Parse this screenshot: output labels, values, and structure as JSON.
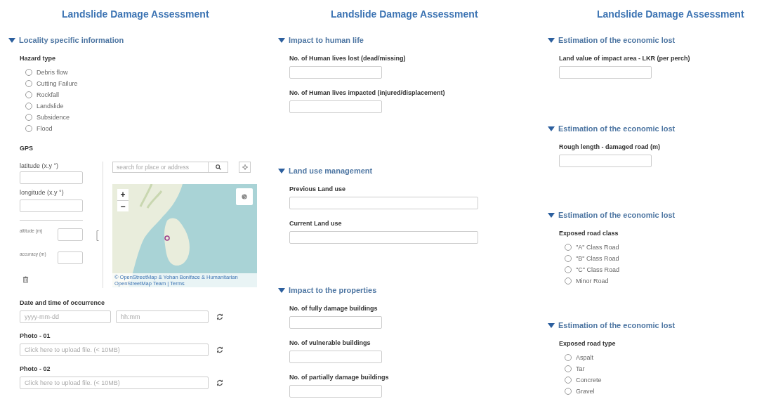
{
  "columns": [
    {
      "title": "Landslide Damage Assessment",
      "sections": [
        {
          "title": "Locality specific information",
          "expanded": true,
          "fields": [
            {
              "kind": "radio",
              "label": "Hazard type",
              "options": [
                {
                  "label": "Debris flow",
                  "selected": false
                },
                {
                  "label": "Cutting Failure",
                  "selected": false
                },
                {
                  "label": "Rockfall",
                  "selected": false
                },
                {
                  "label": "Landslide",
                  "selected": false
                },
                {
                  "label": "Subsidence",
                  "selected": false
                },
                {
                  "label": "Flood",
                  "selected": false
                }
              ]
            },
            {
              "kind": "gps",
              "label": "GPS",
              "latitude_label": "latitude (x.y °)",
              "longitude_label": "longitude (x.y °)",
              "altitude_label": "altitude (m)",
              "accuracy_label": "accuracy (m)",
              "search_placeholder": "search for place or address",
              "zoom_in": "+",
              "zoom_out": "−",
              "attribution": "© OpenStreetMap & Yohan Boniface & Humanitarian OpenStreetMap Team | Terms"
            },
            {
              "kind": "datetime",
              "label": "Date and time of occurrence",
              "date_placeholder": "yyyy-mm-dd",
              "time_placeholder": "hh:mm"
            },
            {
              "kind": "upload",
              "label": "Photo - 01",
              "placeholder": "Click here to upload file. (< 10MB)"
            },
            {
              "kind": "upload",
              "label": "Photo - 02",
              "placeholder": "Click here to upload file. (< 10MB)"
            }
          ]
        }
      ]
    },
    {
      "title": "Landslide Damage Assessment",
      "sections": [
        {
          "title": "Impact to human life",
          "expanded": true,
          "fields": [
            {
              "kind": "text",
              "label": "No. of Human lives lost (dead/missing)"
            },
            {
              "kind": "text",
              "label": "No. of Human lives impacted (injured/displacement)"
            }
          ]
        },
        {
          "title": "Land use management",
          "expanded": true,
          "fields": [
            {
              "kind": "text",
              "label": "Previous Land use"
            },
            {
              "kind": "text",
              "label": "Current Land use"
            }
          ]
        },
        {
          "title": "Impact to the properties",
          "expanded": true,
          "fields": [
            {
              "kind": "text",
              "label": "No. of fully damage buildings"
            },
            {
              "kind": "text",
              "label": "No. of vulnerable buildings"
            },
            {
              "kind": "text",
              "label": "No. of partially damage buildings"
            }
          ]
        }
      ]
    },
    {
      "title": "Landslide Damage Assessment",
      "sections": [
        {
          "title": "Estimation of the economic lost",
          "expanded": true,
          "fields": [
            {
              "kind": "text",
              "label": "Land value of impact area - LKR (per perch)"
            }
          ]
        },
        {
          "title": "Estimation of the economic lost",
          "expanded": true,
          "fields": [
            {
              "kind": "text",
              "label": "Rough length - damaged road (m)"
            }
          ]
        },
        {
          "title": "Estimation of the economic lost",
          "expanded": true,
          "fields": [
            {
              "kind": "radio",
              "label": "Exposed road class",
              "options": [
                {
                  "label": "\"A\" Class Road",
                  "selected": false
                },
                {
                  "label": "\"B\" Class Road",
                  "selected": false
                },
                {
                  "label": "\"C\" Class Road",
                  "selected": false
                },
                {
                  "label": "Minor Road",
                  "selected": false
                }
              ]
            }
          ]
        },
        {
          "title": "Estimation of the economic lost",
          "expanded": true,
          "fields": [
            {
              "kind": "radio",
              "label": "Exposed road type",
              "options": [
                {
                  "label": "Aspalt",
                  "selected": false
                },
                {
                  "label": "Tar",
                  "selected": false
                },
                {
                  "label": "Concrete",
                  "selected": false
                },
                {
                  "label": "Gravel",
                  "selected": false
                }
              ]
            }
          ]
        }
      ]
    }
  ]
}
